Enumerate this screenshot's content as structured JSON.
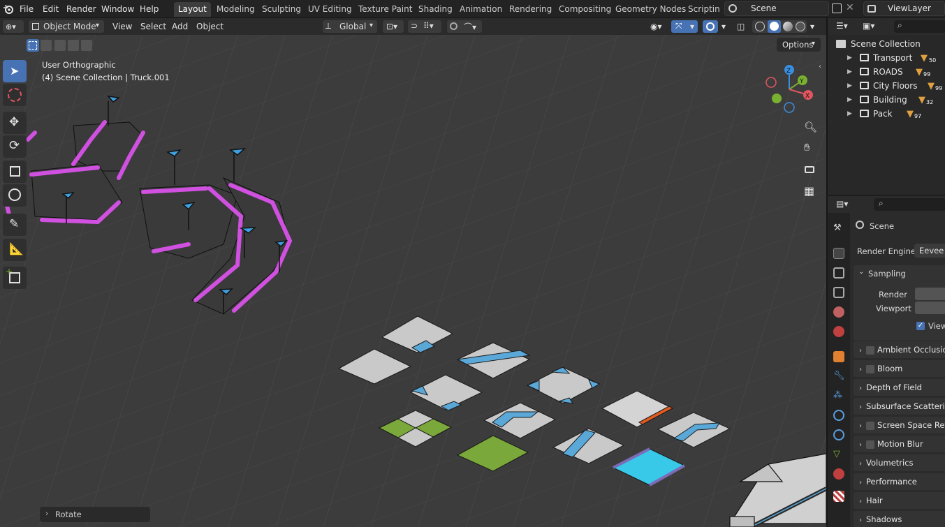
{
  "menu": [
    "File",
    "Edit",
    "Render",
    "Window",
    "Help"
  ],
  "workspaces": [
    "Layout",
    "Modeling",
    "Sculpting",
    "UV Editing",
    "Texture Paint",
    "Shading",
    "Animation",
    "Rendering",
    "Compositing",
    "Geometry Nodes",
    "Scripting"
  ],
  "active_workspace": "Layout",
  "scene_name": "Scene",
  "view_layer": "ViewLayer",
  "header": {
    "mode": "Object Mode",
    "menus": [
      "View",
      "Select",
      "Add",
      "Object"
    ],
    "transform_orientation": "Global",
    "options_label": "Options"
  },
  "viewport": {
    "view_name": "User Orthographic",
    "collection_info": "(4) Scene Collection | Truck.001",
    "last_operator": "Rotate",
    "gizmo": {
      "z": "Z",
      "y": "Y",
      "x": "X"
    }
  },
  "outliner": {
    "root": "Scene Collection",
    "collections": [
      {
        "name": "Transport",
        "count": "50"
      },
      {
        "name": "ROADS",
        "count": "99"
      },
      {
        "name": "City Floors",
        "count": "99"
      },
      {
        "name": "Building",
        "count": "32"
      },
      {
        "name": "Pack",
        "count": "97"
      }
    ]
  },
  "properties": {
    "context": "Scene",
    "render_engine_label": "Render Engine",
    "render_engine_value": "Eevee",
    "sampling": "Sampling",
    "render_label": "Render",
    "viewport_label": "Viewport",
    "viewport_denoise": "Viewp",
    "panels": [
      "Ambient Occlusion",
      "Bloom",
      "Depth of Field",
      "Subsurface Scattering",
      "Screen Space Refle",
      "Motion Blur",
      "Volumetrics",
      "Performance",
      "Hair",
      "Shadows"
    ]
  },
  "colors": {
    "accent": "#4772b3",
    "road_edge": "#c050d0",
    "tile_grey": "#c8c8c8",
    "tile_blue": "#5aa8d8",
    "tile_green": "#7aa83a",
    "tile_cyan": "#38c8e8",
    "gizmo_x": "#e05560",
    "gizmo_y": "#7ab030",
    "gizmo_z": "#3a8ee0"
  }
}
